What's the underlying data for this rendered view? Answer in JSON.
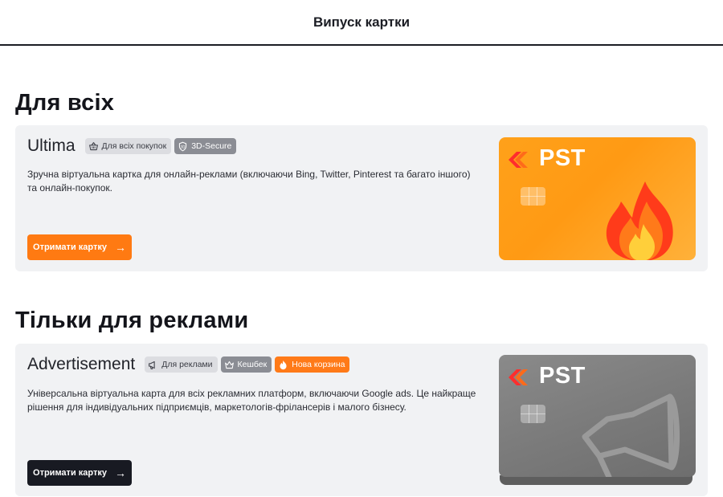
{
  "header": {
    "title": "Випуск картки"
  },
  "sections": [
    {
      "title": "Для всіх",
      "card": {
        "name": "Ultima",
        "badges": [
          {
            "label": "Для всіх покупок",
            "icon": "basket-icon",
            "style": "light"
          },
          {
            "label": "3D-Secure",
            "icon": "shield-icon",
            "style": "dark"
          }
        ],
        "description": "Зручна віртуальна картка для онлайн-реклами (включаючи Bing, Twitter, Pinterest та багато іншого) та онлайн-покупок.",
        "button_label": "Отримати картку",
        "button_color": "#ff7a12",
        "visual": {
          "brand": "PST",
          "theme": "orange",
          "art": "fire-icon"
        }
      }
    },
    {
      "title": "Тільки для реклами",
      "card": {
        "name": "Advertisement",
        "badges": [
          {
            "label": "Для реклами",
            "icon": "megaphone-icon",
            "style": "light"
          },
          {
            "label": "Кешбек",
            "icon": "crown-icon",
            "style": "dark"
          },
          {
            "label": "Нова корзина",
            "icon": "flame-icon",
            "style": "orange"
          }
        ],
        "description": "Універсальна віртуальна карта для всіх рекламних платформ, включаючи Google ads. Це найкраще рішення для індивідуальних підприємців, маркетологів-фрілансерів і малого бізнесу.",
        "button_label": "Отримати картку",
        "button_color": "#181a22",
        "visual": {
          "brand": "PST",
          "theme": "gray",
          "art": "megaphone-icon"
        }
      }
    }
  ]
}
